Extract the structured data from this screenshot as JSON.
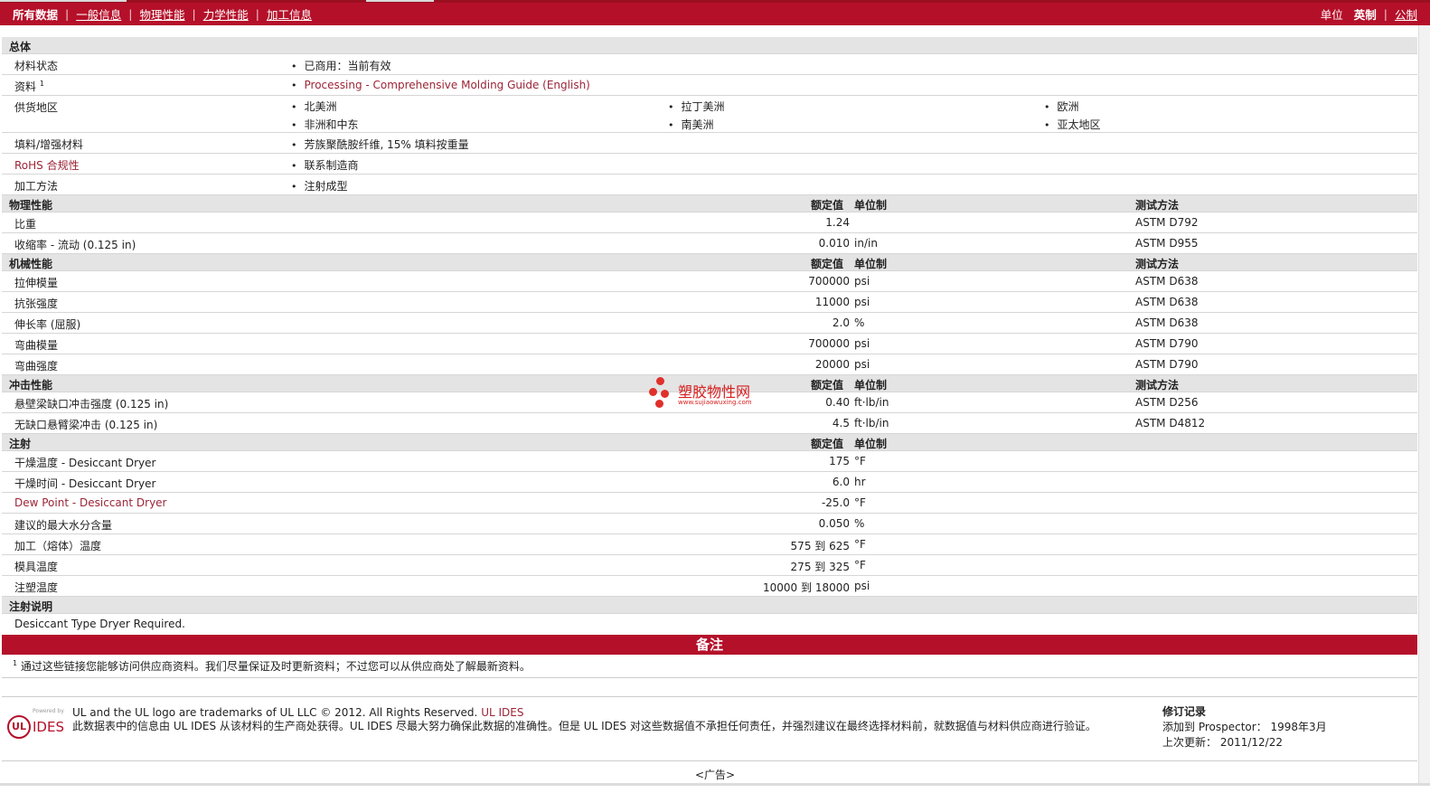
{
  "nav": {
    "all": "所有数据",
    "links": [
      "一般信息",
      "物理性能",
      "力学性能",
      "加工信息"
    ],
    "units_label": "单位",
    "unit_current": "英制",
    "unit_other": "公制"
  },
  "general": {
    "title": "总体",
    "status_label": "材料状态",
    "status_value": "已商用：当前有效",
    "docs_label": "资料",
    "docs_sup": "1",
    "docs_value": "Processing - Comprehensive Molding Guide (English)",
    "supply_label": "供货地区",
    "supply": [
      "北美洲",
      "拉丁美洲",
      "欧洲",
      "非洲和中东",
      "南美洲",
      "亚太地区"
    ],
    "filler_label": "填料/增强材料",
    "filler_value": "芳族聚酰胺纤维, 15% 填料按重量",
    "rohs_label": "RoHS 合规性",
    "rohs_value": "联系制造商",
    "method_label": "加工方法",
    "method_value": "注射成型"
  },
  "headers": {
    "nominal": "额定值",
    "unit": "单位制",
    "test": "测试方法"
  },
  "physical": {
    "title": "物理性能",
    "rows": [
      {
        "label": "比重",
        "value": "1.24",
        "unit": "",
        "method": "ASTM D792"
      },
      {
        "label": "收缩率 - 流动 (0.125 in)",
        "value": "0.010",
        "unit": "in/in",
        "method": "ASTM D955"
      }
    ]
  },
  "mechanical": {
    "title": "机械性能",
    "rows": [
      {
        "label": "拉伸模量",
        "value": "700000",
        "unit": "psi",
        "method": "ASTM D638"
      },
      {
        "label": "抗张强度",
        "value": "11000",
        "unit": "psi",
        "method": "ASTM D638"
      },
      {
        "label": "伸长率 (屈服)",
        "value": "2.0",
        "unit": "%",
        "method": "ASTM D638"
      },
      {
        "label": "弯曲模量",
        "value": "700000",
        "unit": "psi",
        "method": "ASTM D790"
      },
      {
        "label": "弯曲强度",
        "value": "20000",
        "unit": "psi",
        "method": "ASTM D790"
      }
    ]
  },
  "impact": {
    "title": "冲击性能",
    "rows": [
      {
        "label": "悬壁梁缺口冲击强度 (0.125 in)",
        "value": "0.40",
        "unit": "ft·lb/in",
        "method": "ASTM D256"
      },
      {
        "label": "无缺口悬臂梁冲击 (0.125 in)",
        "value": "4.5",
        "unit": "ft·lb/in",
        "method": "ASTM D4812"
      }
    ]
  },
  "injection": {
    "title": "注射",
    "rows": [
      {
        "label": "干燥温度 - Desiccant Dryer",
        "value": "175",
        "unit": "°F",
        "red": false
      },
      {
        "label": "干燥时间 - Desiccant Dryer",
        "value": "6.0",
        "unit": "hr",
        "red": false
      },
      {
        "label": "Dew Point - Desiccant Dryer",
        "value": "-25.0",
        "unit": "°F",
        "red": true
      },
      {
        "label": "建议的最大水分含量",
        "value": "0.050",
        "unit": "%",
        "red": false
      },
      {
        "label": "加工（熔体）温度",
        "value": "575 到  625",
        "unit": "°F",
        "red": false
      },
      {
        "label": "模具温度",
        "value": "275 到  325",
        "unit": "°F",
        "red": false
      },
      {
        "label": "注塑温度",
        "value": "10000 到  18000",
        "unit": "psi",
        "red": false
      }
    ]
  },
  "inj_notes": {
    "title": "注射说明",
    "text": "Desiccant Type Dryer Required."
  },
  "notes": {
    "title": "备注",
    "sup": "1",
    "text": "通过这些链接您能够访问供应商资料。我们尽量保证及时更新资料；不过您可以从供应商处了解最新资料。"
  },
  "footer": {
    "logo_small": "Powered by",
    "logo_ul": "UL",
    "logo_ides": "IDES",
    "line1": "UL and the UL logo are trademarks of UL LLC © 2012. All Rights Reserved.",
    "line1_link": "UL IDES",
    "line2": "此数据表中的信息由 UL IDES 从该材料的生产商处获得。UL IDES 尽最大努力确保此数据的准确性。但是 UL IDES 对这些数据值不承担任何责任，并强烈建议在最终选择材料前，就数据值与材料供应商进行验证。",
    "rev_title": "修订记录",
    "rev_added": "添加到 Prospector： 1998年3月",
    "rev_updated": "上次更新： 2011/12/22"
  },
  "ad": "<广告>",
  "watermark": {
    "name": "塑胶物性网",
    "url": "www.sujiaowuxing.com"
  },
  "colors": {
    "brand": "#b5102a",
    "section_bg": "#e4e4e4",
    "link": "#9c2436"
  }
}
